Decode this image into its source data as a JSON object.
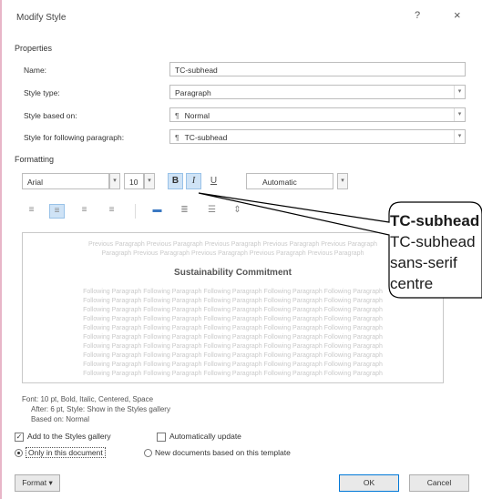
{
  "dialog": {
    "title": "Modify Style",
    "help_glyph": "?",
    "close_glyph": "×"
  },
  "properties": {
    "group_label": "Properties",
    "name_label": "Name:",
    "name_value": "TC-subhead",
    "style_type_label": "Style type:",
    "style_type_value": "Paragraph",
    "based_on_label": "Style based on:",
    "based_on_value": "Normal",
    "following_label": "Style for following paragraph:",
    "following_value": "TC-subhead",
    "para_mark": "¶"
  },
  "formatting": {
    "group_label": "Formatting",
    "font": "Arial",
    "size": "10",
    "bold_glyph": "B",
    "italic_glyph": "I",
    "underline_glyph": "U",
    "color": "Automatic"
  },
  "preview": {
    "prev_para_line1": "Previous Paragraph Previous Paragraph Previous Paragraph Previous Paragraph Previous Paragraph",
    "prev_para_line2": "Paragraph Previous Paragraph Previous Paragraph Previous Paragraph Previous Paragraph",
    "heading": "Sustainability Commitment",
    "following_line": "Following Paragraph Following Paragraph Following Paragraph Following Paragraph Following Paragraph"
  },
  "description": {
    "line1": "Font: 10 pt, Bold, Italic, Centered, Space",
    "line2": "After:  6 pt, Style: Show in the Styles gallery",
    "line3": "Based on: Normal"
  },
  "options": {
    "add_to_gallery": "Add to the Styles gallery",
    "auto_update": "Automatically update",
    "only_this_doc": "Only in this document",
    "new_docs": "New documents based on this template"
  },
  "buttons": {
    "format": "Format ▾",
    "ok": "OK",
    "cancel": "Cancel"
  },
  "callout": {
    "title": "TC-subhead",
    "line1": "TC-subhead",
    "line2": "sans-serif",
    "line3": "centre"
  },
  "colors": {
    "accent_active": "#cfe3f6",
    "callout_fill": "#ffffff",
    "callout_stroke": "#000000"
  }
}
